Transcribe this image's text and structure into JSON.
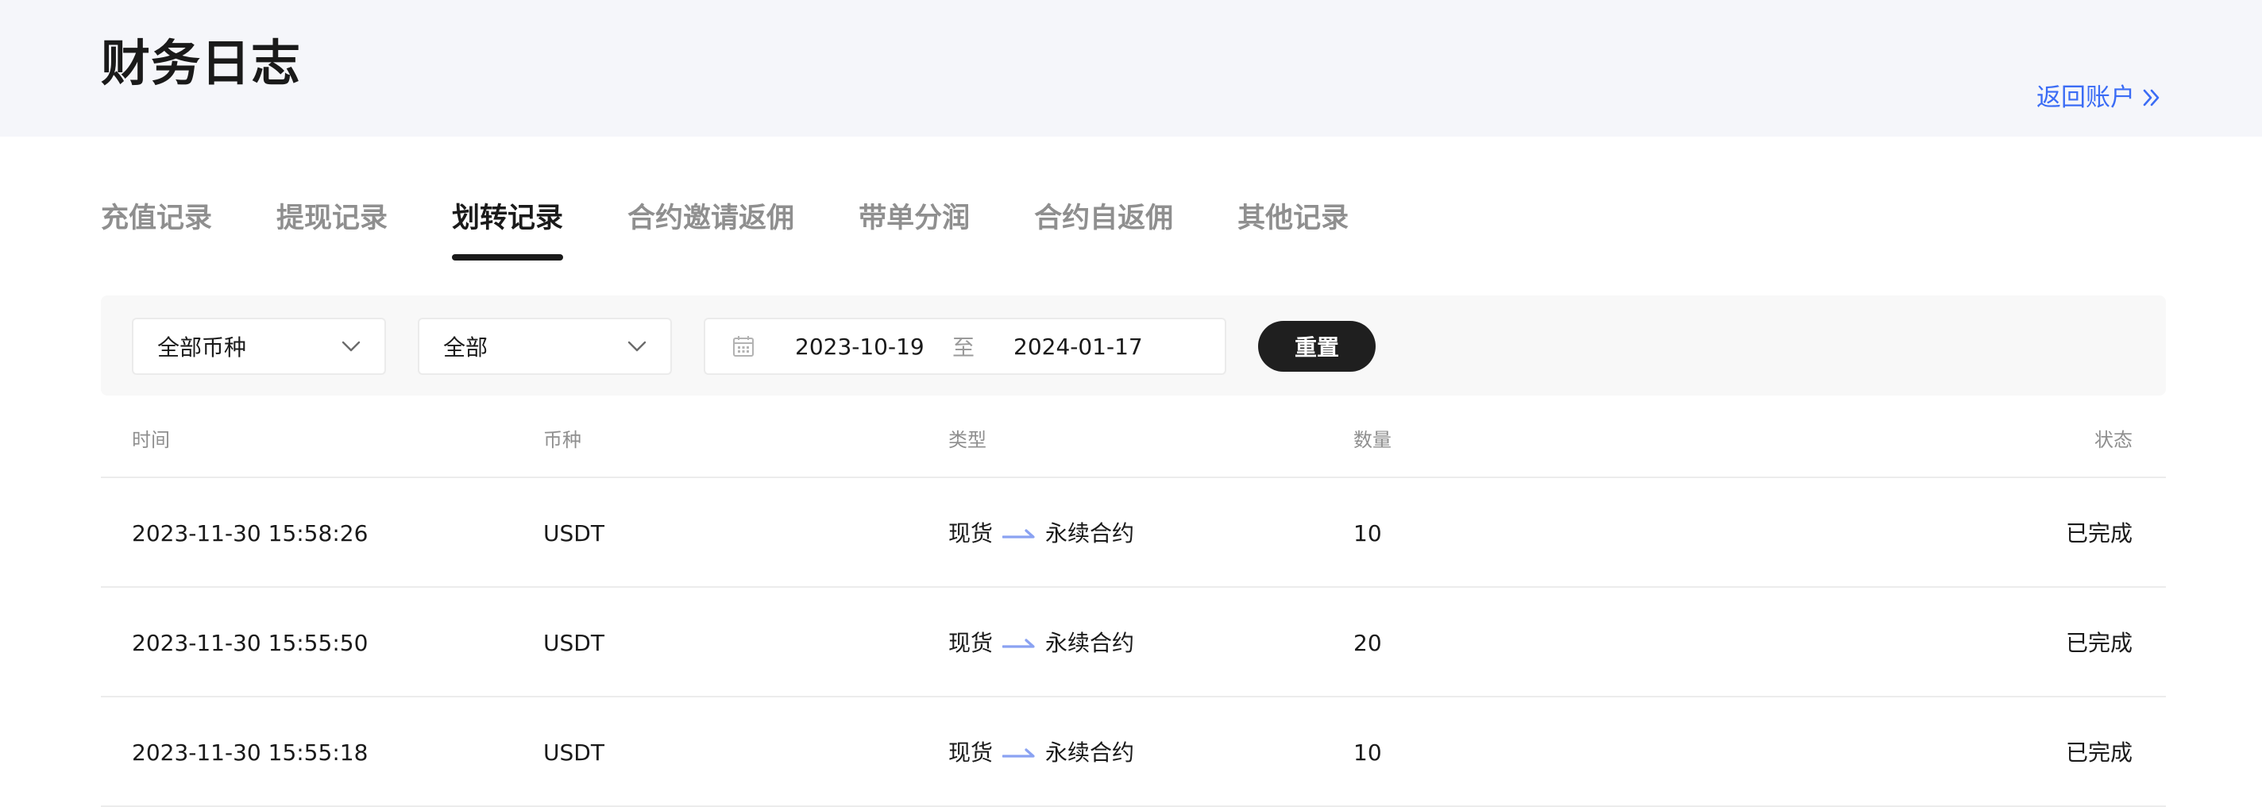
{
  "header": {
    "title": "财务日志",
    "back_label": "返回账户"
  },
  "tabs": [
    {
      "label": "充值记录",
      "active": false
    },
    {
      "label": "提现记录",
      "active": false
    },
    {
      "label": "划转记录",
      "active": true
    },
    {
      "label": "合约邀请返佣",
      "active": false
    },
    {
      "label": "带单分润",
      "active": false
    },
    {
      "label": "合约自返佣",
      "active": false
    },
    {
      "label": "其他记录",
      "active": false
    }
  ],
  "filters": {
    "coin_select": "全部币种",
    "type_select": "全部",
    "date_start": "2023-10-19",
    "date_separator": "至",
    "date_end": "2024-01-17",
    "reset_label": "重置"
  },
  "table": {
    "headers": {
      "time": "时间",
      "coin": "币种",
      "type": "类型",
      "amount": "数量",
      "status": "状态"
    },
    "rows": [
      {
        "time": "2023-11-30 15:58:26",
        "coin": "USDT",
        "from": "现货",
        "to": "永续合约",
        "amount": "10",
        "status": "已完成"
      },
      {
        "time": "2023-11-30 15:55:50",
        "coin": "USDT",
        "from": "现货",
        "to": "永续合约",
        "amount": "20",
        "status": "已完成"
      },
      {
        "time": "2023-11-30 15:55:18",
        "coin": "USDT",
        "from": "现货",
        "to": "永续合约",
        "amount": "10",
        "status": "已完成"
      }
    ]
  },
  "colors": {
    "accent": "#3b6cf5",
    "arrow": "#8aa2f2",
    "header_bg": "#f5f6fa",
    "button_bg": "#1f1f1f"
  },
  "icons": {
    "back": "double-chevron-right-icon",
    "dropdown": "chevron-down-icon",
    "calendar": "calendar-icon",
    "transfer": "arrow-right-icon"
  }
}
